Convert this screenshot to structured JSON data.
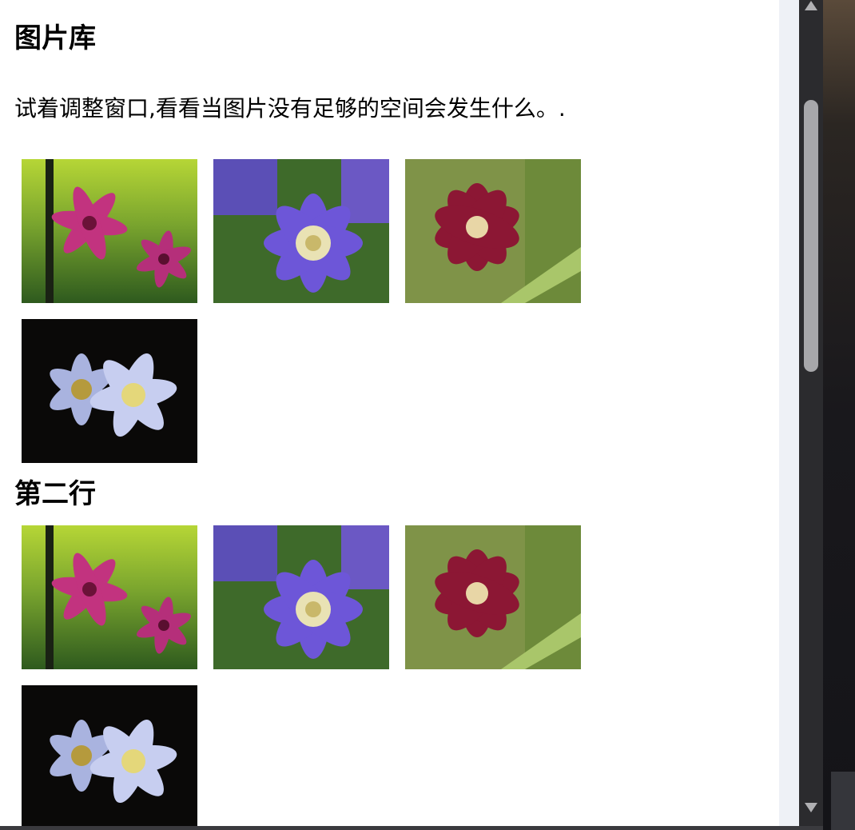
{
  "page": {
    "title": "图片库",
    "description": "试着调整窗口,看看当图片没有足够的空间会发生什么。.",
    "section2_title": "第二行"
  },
  "gallery_rows": [
    {
      "images": [
        {
          "name": "pink-clematis-image",
          "subject": "pink flower"
        },
        {
          "name": "purple-clematis-image",
          "subject": "purple flower"
        },
        {
          "name": "red-clematis-image",
          "subject": "crimson flower"
        },
        {
          "name": "lavender-clematis-image",
          "subject": "lavender flower"
        }
      ]
    },
    {
      "images": [
        {
          "name": "pink-clematis-image",
          "subject": "pink flower"
        },
        {
          "name": "purple-clematis-image",
          "subject": "purple flower"
        },
        {
          "name": "red-clematis-image",
          "subject": "crimson flower"
        },
        {
          "name": "lavender-clematis-image",
          "subject": "lavender flower"
        }
      ]
    }
  ],
  "colors": {
    "page_bg": "#ffffff",
    "scrollbar_track": "#2b2b2e",
    "scrollbar_thumb": "#a7a7aa",
    "gutter": "#eef1f6"
  },
  "icons": {
    "scroll_up": "triangle-up-icon",
    "scroll_down": "triangle-down-icon"
  }
}
